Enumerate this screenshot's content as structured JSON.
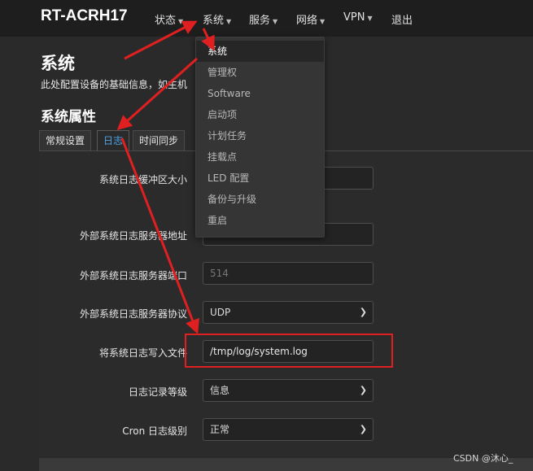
{
  "topbar": {
    "brand": "RT-ACRH17",
    "nav": [
      {
        "label": "状态"
      },
      {
        "label": "系统"
      },
      {
        "label": "服务"
      },
      {
        "label": "网络"
      },
      {
        "label": "VPN"
      },
      {
        "label": "退出"
      }
    ]
  },
  "page": {
    "title": "系统",
    "description": "此处配置设备的基础信息，如主机",
    "section_title": "系统属性"
  },
  "tabs": [
    {
      "label": "常规设置",
      "active": false
    },
    {
      "label": "日志",
      "active": true
    },
    {
      "label": "时间同步",
      "active": false
    }
  ],
  "form": {
    "buffer_size": {
      "label": "系统日志缓冲区大小",
      "value": ""
    },
    "remote_host": {
      "label": "外部系统日志服务器地址",
      "placeholder": "0.0.0.0"
    },
    "remote_port": {
      "label": "外部系统日志服务器端口",
      "placeholder": "514"
    },
    "remote_proto": {
      "label": "外部系统日志服务器协议",
      "value": "UDP"
    },
    "log_file": {
      "label": "将系统日志写入文件",
      "value": "/tmp/log/system.log"
    },
    "log_level": {
      "label": "日志记录等级",
      "value": "信息"
    },
    "cron_level": {
      "label": "Cron 日志级别",
      "value": "正常"
    }
  },
  "dropdown": {
    "items": [
      {
        "label": "系统",
        "active": true
      },
      {
        "label": "管理权",
        "active": false
      },
      {
        "label": "Software",
        "active": false
      },
      {
        "label": "启动项",
        "active": false
      },
      {
        "label": "计划任务",
        "active": false
      },
      {
        "label": "挂载点",
        "active": false
      },
      {
        "label": "LED 配置",
        "active": false
      },
      {
        "label": "备份与升级",
        "active": false
      },
      {
        "label": "重启",
        "active": false
      }
    ]
  },
  "annotation": {
    "color": "#e02020"
  },
  "watermark": "CSDN @沐心_",
  "icons": {
    "caret": "caret-down-icon",
    "select": "chevron-down-icon"
  }
}
